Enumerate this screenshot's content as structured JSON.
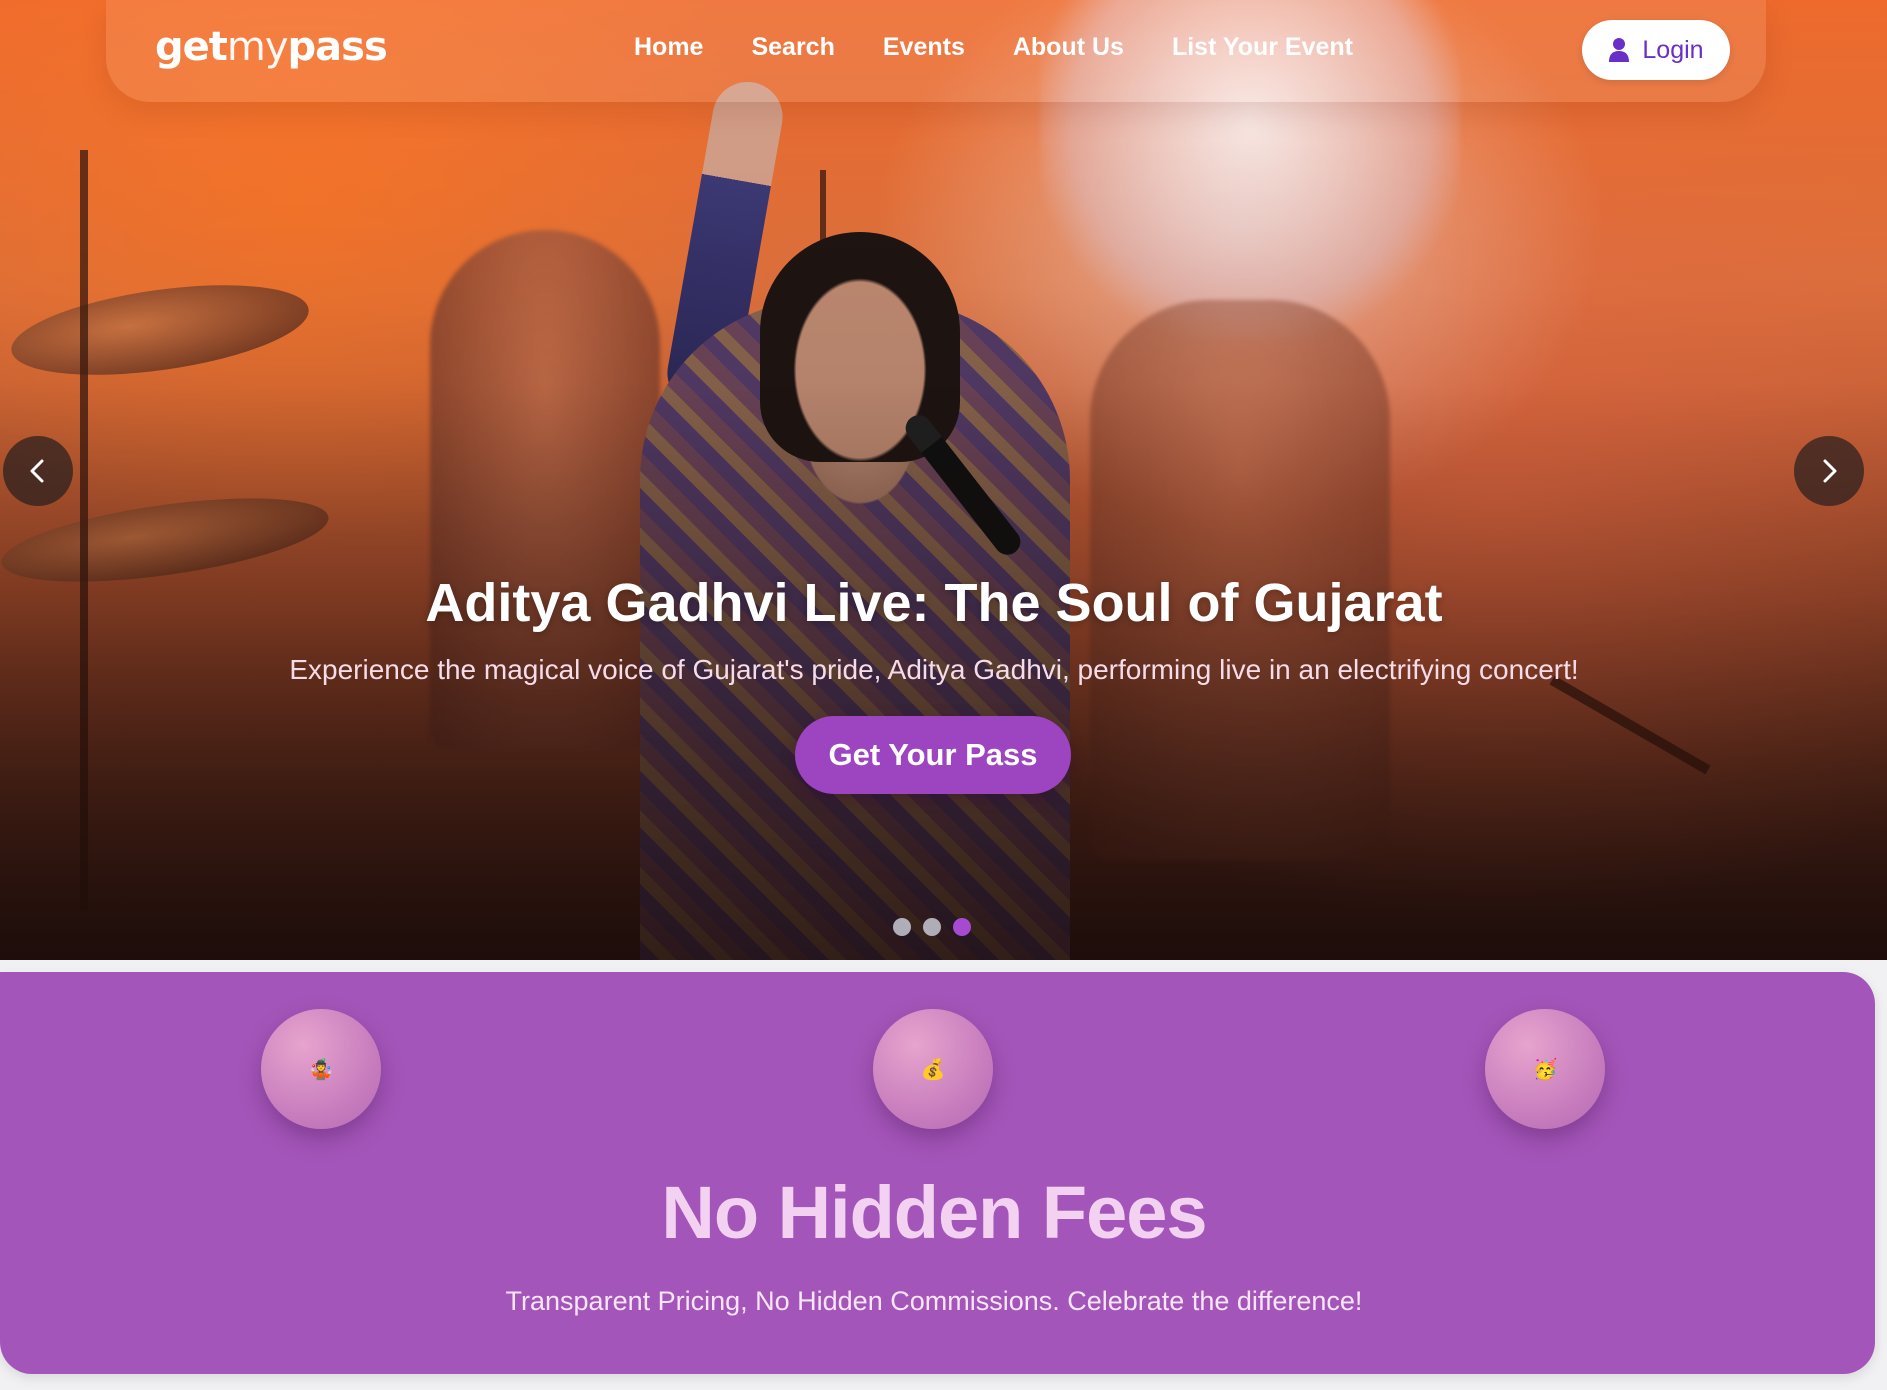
{
  "brand": {
    "logo_bold": "get",
    "logo_light": "my",
    "logo_tail": "pass"
  },
  "nav": {
    "links": [
      "Home",
      "Search",
      "Events",
      "About Us",
      "List Your Event"
    ],
    "login_label": "Login"
  },
  "hero": {
    "title": "Aditya Gadhvi Live: The Soul of Gujarat",
    "subtitle": "Experience the magical voice of Gujarat's pride, Aditya Gadhvi, performing live in an electrifying concert!",
    "cta_label": "Get Your Pass",
    "slides_total": 3,
    "active_slide": 3
  },
  "feature": {
    "icons": [
      "🤹",
      "💰",
      "🥳"
    ],
    "title": "No Hidden Fees",
    "subtitle": "Transparent Pricing, No Hidden Commissions. Celebrate the difference!"
  },
  "colors": {
    "accent": "#9d44c0",
    "feature_bg": "#a455b9",
    "login_text": "#6a2fc8"
  }
}
